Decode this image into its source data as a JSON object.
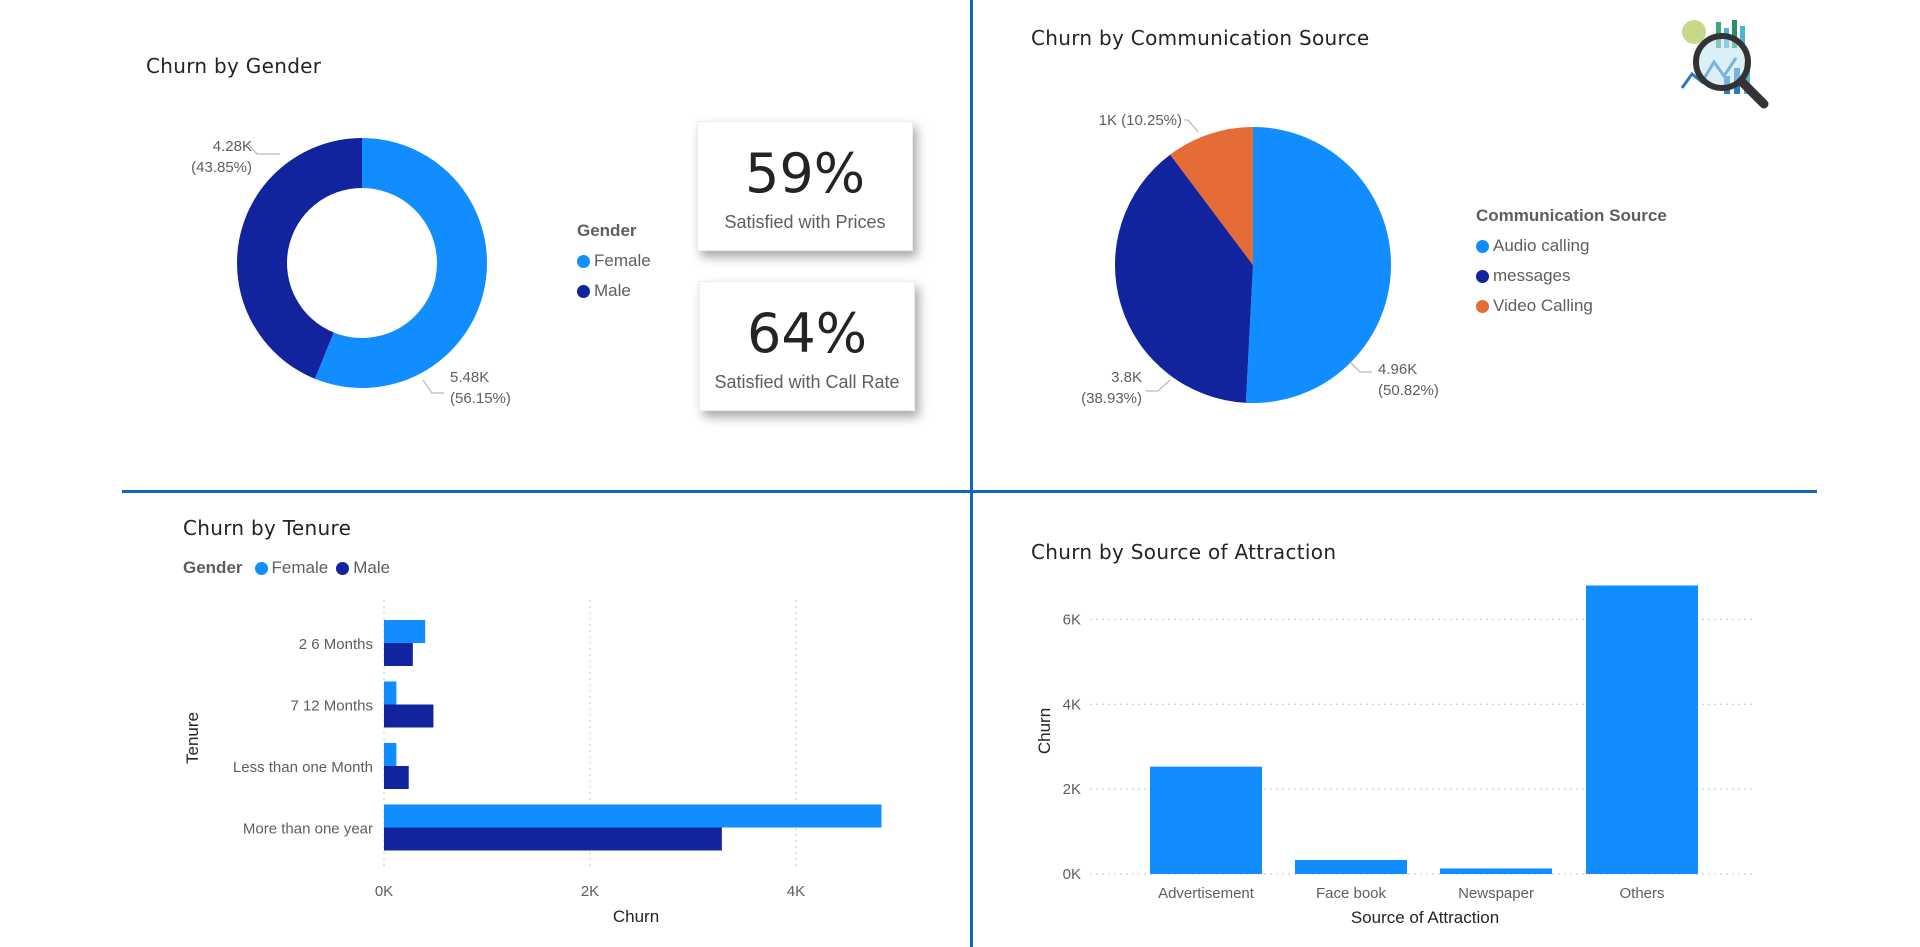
{
  "colors": {
    "female": "#118dff",
    "male": "#12239e",
    "video": "#e66c37",
    "divider": "#1565c0"
  },
  "logo_icon": "magnifier-analytics-icon",
  "gender_panel": {
    "title": "Churn by Gender",
    "legend_title": "Gender",
    "legend_items": [
      "Female",
      "Male"
    ]
  },
  "kpis": [
    {
      "value": "59%",
      "label": "Satisfied with Prices"
    },
    {
      "value": "64%",
      "label": "Satisfied with Call Rate"
    }
  ],
  "comm_panel": {
    "title": "Churn by Communication Source",
    "legend_title": "Communication Source",
    "legend_items": [
      "Audio calling",
      "messages",
      "Video Calling"
    ]
  },
  "tenure_panel": {
    "title": "Churn by Tenure",
    "legend_title": "Gender",
    "legend_items": [
      "Female",
      "Male"
    ]
  },
  "attraction_panel": {
    "title": "Churn by Source of Attraction"
  },
  "chart_data": [
    {
      "type": "pie",
      "variant": "donut",
      "title": "Churn by Gender",
      "categories": [
        "Female",
        "Male"
      ],
      "values": [
        5480,
        4280
      ],
      "labels": [
        {
          "value": "5.48K",
          "pct": "(56.15%)"
        },
        {
          "value": "4.28K",
          "pct": "(43.85%)"
        }
      ]
    },
    {
      "type": "pie",
      "title": "Churn by Communication Source",
      "categories": [
        "Audio calling",
        "messages",
        "Video Calling"
      ],
      "values": [
        4960,
        3800,
        1000
      ],
      "labels": [
        {
          "value": "4.96K",
          "pct": "(50.82%)"
        },
        {
          "value": "3.8K",
          "pct": "(38.93%)"
        },
        {
          "value": "1K (10.25%)",
          "pct": ""
        }
      ]
    },
    {
      "type": "bar",
      "orientation": "horizontal",
      "title": "Churn by Tenure",
      "categories": [
        "2 6 Months",
        "7 12 Months",
        "Less than one Month",
        "More than one year"
      ],
      "series": [
        {
          "name": "Female",
          "values": [
            400,
            120,
            120,
            4830
          ]
        },
        {
          "name": "Male",
          "values": [
            280,
            480,
            240,
            3280
          ]
        }
      ],
      "xlabel": "Churn",
      "ylabel": "Tenure",
      "xticks": [
        "0K",
        "2K",
        "4K"
      ],
      "xlim": [
        0,
        5000
      ],
      "grid": true
    },
    {
      "type": "bar",
      "title": "Churn by Source of Attraction",
      "categories": [
        "Advertisement",
        "Face book",
        "Newspaper",
        "Others"
      ],
      "values": [
        2530,
        330,
        130,
        6800
      ],
      "xlabel": "Source of Attraction",
      "ylabel": "Churn",
      "yticks": [
        "0K",
        "2K",
        "4K",
        "6K"
      ],
      "ylim": [
        0,
        7000
      ],
      "grid": true
    }
  ]
}
